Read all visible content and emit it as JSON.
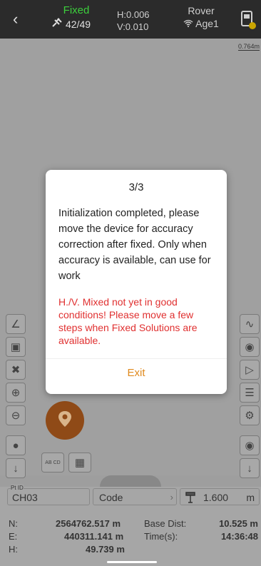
{
  "status": {
    "fix_state": "Fixed",
    "satellites": "42/49",
    "h_precision": "H:0.006",
    "v_precision": "V:0.010",
    "mode": "Rover",
    "age": "Age1",
    "fix_color": "#3ccf3c"
  },
  "map": {
    "scale": "0.764m"
  },
  "left_tools": [
    {
      "icon": "measure-angle-icon"
    },
    {
      "icon": "focus-icon"
    },
    {
      "icon": "collapse-icon"
    },
    {
      "icon": "zoom-in-icon"
    },
    {
      "icon": "zoom-out-icon"
    },
    {
      "icon": "globe-icon"
    },
    {
      "icon": "expand-down-icon"
    }
  ],
  "right_tools": [
    {
      "icon": "curve-settings-icon"
    },
    {
      "icon": "location-icon"
    },
    {
      "icon": "stakeout-icon"
    },
    {
      "icon": "list-icon"
    },
    {
      "icon": "settings-icon"
    },
    {
      "icon": "mixed-icon"
    },
    {
      "icon": "expand-down-icon"
    }
  ],
  "mini_tools": {
    "label_text": "AB CD"
  },
  "dialog": {
    "title": "3/3",
    "body": "Initialization completed, please move the device for accuracy correction after fixed. Only when accuracy is available, can use for work",
    "warning": "H./V. Mixed not yet in good conditions! Please move a few steps when Fixed Solutions are available.",
    "exit_label": "Exit",
    "warning_color": "#e03030",
    "accent_color": "#e08a1e"
  },
  "point": {
    "ptid_label": "Pt ID",
    "ptid_value": "CH03",
    "code_label": "Code",
    "antenna_height": "1.600",
    "antenna_unit": "m"
  },
  "coords": {
    "n_label": "N:",
    "n_value": "2564762.517 m",
    "e_label": "E:",
    "e_value": "440311.141 m",
    "h_label": "H:",
    "h_value": "49.739 m",
    "base_dist_label": "Base Dist:",
    "base_dist_value": "10.525 m",
    "time_label": "Time(s):",
    "time_value": "14:36:48"
  }
}
